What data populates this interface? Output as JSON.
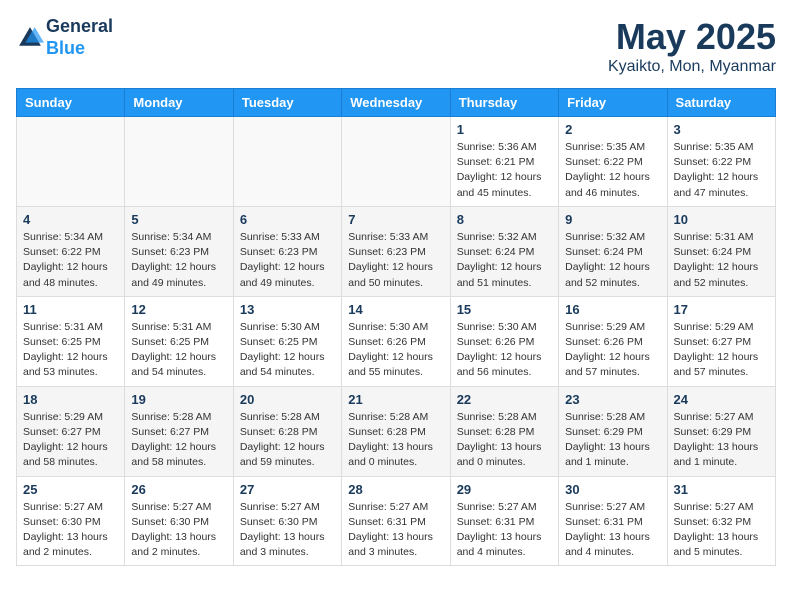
{
  "header": {
    "logo_line1": "General",
    "logo_line2": "Blue",
    "month_title": "May 2025",
    "location": "Kyaikto, Mon, Myanmar"
  },
  "weekdays": [
    "Sunday",
    "Monday",
    "Tuesday",
    "Wednesday",
    "Thursday",
    "Friday",
    "Saturday"
  ],
  "weeks": [
    [
      {
        "day": "",
        "info": ""
      },
      {
        "day": "",
        "info": ""
      },
      {
        "day": "",
        "info": ""
      },
      {
        "day": "",
        "info": ""
      },
      {
        "day": "1",
        "info": "Sunrise: 5:36 AM\nSunset: 6:21 PM\nDaylight: 12 hours\nand 45 minutes."
      },
      {
        "day": "2",
        "info": "Sunrise: 5:35 AM\nSunset: 6:22 PM\nDaylight: 12 hours\nand 46 minutes."
      },
      {
        "day": "3",
        "info": "Sunrise: 5:35 AM\nSunset: 6:22 PM\nDaylight: 12 hours\nand 47 minutes."
      }
    ],
    [
      {
        "day": "4",
        "info": "Sunrise: 5:34 AM\nSunset: 6:22 PM\nDaylight: 12 hours\nand 48 minutes."
      },
      {
        "day": "5",
        "info": "Sunrise: 5:34 AM\nSunset: 6:23 PM\nDaylight: 12 hours\nand 49 minutes."
      },
      {
        "day": "6",
        "info": "Sunrise: 5:33 AM\nSunset: 6:23 PM\nDaylight: 12 hours\nand 49 minutes."
      },
      {
        "day": "7",
        "info": "Sunrise: 5:33 AM\nSunset: 6:23 PM\nDaylight: 12 hours\nand 50 minutes."
      },
      {
        "day": "8",
        "info": "Sunrise: 5:32 AM\nSunset: 6:24 PM\nDaylight: 12 hours\nand 51 minutes."
      },
      {
        "day": "9",
        "info": "Sunrise: 5:32 AM\nSunset: 6:24 PM\nDaylight: 12 hours\nand 52 minutes."
      },
      {
        "day": "10",
        "info": "Sunrise: 5:31 AM\nSunset: 6:24 PM\nDaylight: 12 hours\nand 52 minutes."
      }
    ],
    [
      {
        "day": "11",
        "info": "Sunrise: 5:31 AM\nSunset: 6:25 PM\nDaylight: 12 hours\nand 53 minutes."
      },
      {
        "day": "12",
        "info": "Sunrise: 5:31 AM\nSunset: 6:25 PM\nDaylight: 12 hours\nand 54 minutes."
      },
      {
        "day": "13",
        "info": "Sunrise: 5:30 AM\nSunset: 6:25 PM\nDaylight: 12 hours\nand 54 minutes."
      },
      {
        "day": "14",
        "info": "Sunrise: 5:30 AM\nSunset: 6:26 PM\nDaylight: 12 hours\nand 55 minutes."
      },
      {
        "day": "15",
        "info": "Sunrise: 5:30 AM\nSunset: 6:26 PM\nDaylight: 12 hours\nand 56 minutes."
      },
      {
        "day": "16",
        "info": "Sunrise: 5:29 AM\nSunset: 6:26 PM\nDaylight: 12 hours\nand 57 minutes."
      },
      {
        "day": "17",
        "info": "Sunrise: 5:29 AM\nSunset: 6:27 PM\nDaylight: 12 hours\nand 57 minutes."
      }
    ],
    [
      {
        "day": "18",
        "info": "Sunrise: 5:29 AM\nSunset: 6:27 PM\nDaylight: 12 hours\nand 58 minutes."
      },
      {
        "day": "19",
        "info": "Sunrise: 5:28 AM\nSunset: 6:27 PM\nDaylight: 12 hours\nand 58 minutes."
      },
      {
        "day": "20",
        "info": "Sunrise: 5:28 AM\nSunset: 6:28 PM\nDaylight: 12 hours\nand 59 minutes."
      },
      {
        "day": "21",
        "info": "Sunrise: 5:28 AM\nSunset: 6:28 PM\nDaylight: 13 hours\nand 0 minutes."
      },
      {
        "day": "22",
        "info": "Sunrise: 5:28 AM\nSunset: 6:28 PM\nDaylight: 13 hours\nand 0 minutes."
      },
      {
        "day": "23",
        "info": "Sunrise: 5:28 AM\nSunset: 6:29 PM\nDaylight: 13 hours\nand 1 minute."
      },
      {
        "day": "24",
        "info": "Sunrise: 5:27 AM\nSunset: 6:29 PM\nDaylight: 13 hours\nand 1 minute."
      }
    ],
    [
      {
        "day": "25",
        "info": "Sunrise: 5:27 AM\nSunset: 6:30 PM\nDaylight: 13 hours\nand 2 minutes."
      },
      {
        "day": "26",
        "info": "Sunrise: 5:27 AM\nSunset: 6:30 PM\nDaylight: 13 hours\nand 2 minutes."
      },
      {
        "day": "27",
        "info": "Sunrise: 5:27 AM\nSunset: 6:30 PM\nDaylight: 13 hours\nand 3 minutes."
      },
      {
        "day": "28",
        "info": "Sunrise: 5:27 AM\nSunset: 6:31 PM\nDaylight: 13 hours\nand 3 minutes."
      },
      {
        "day": "29",
        "info": "Sunrise: 5:27 AM\nSunset: 6:31 PM\nDaylight: 13 hours\nand 4 minutes."
      },
      {
        "day": "30",
        "info": "Sunrise: 5:27 AM\nSunset: 6:31 PM\nDaylight: 13 hours\nand 4 minutes."
      },
      {
        "day": "31",
        "info": "Sunrise: 5:27 AM\nSunset: 6:32 PM\nDaylight: 13 hours\nand 5 minutes."
      }
    ]
  ]
}
